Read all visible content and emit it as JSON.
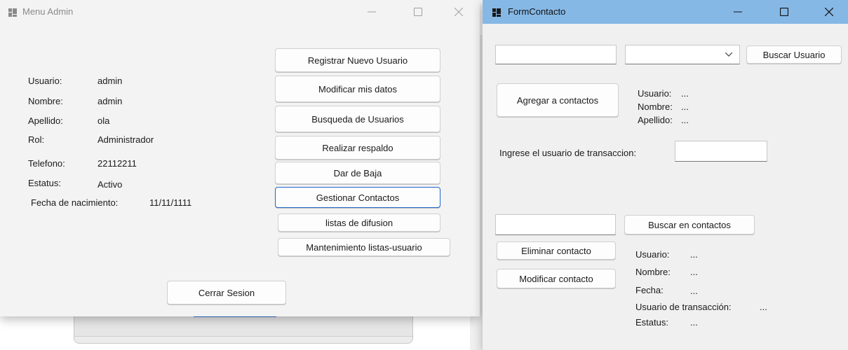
{
  "menu_admin": {
    "title": "Menu Admin",
    "info_labels": {
      "usuario": "Usuario:",
      "nombre": "Nombre:",
      "apellido": "Apellido:",
      "rol": "Rol:",
      "telefono": "Telefono:",
      "estatus": "Estatus:",
      "fecha": "Fecha de nacimiento:"
    },
    "info_values": {
      "usuario": "admin",
      "nombre": "admin",
      "apellido": "ola",
      "rol": "Administrador",
      "telefono": "22112211",
      "estatus": "Activo",
      "fecha": "11/11/1111"
    },
    "buttons": {
      "registrar": "Registrar Nuevo Usuario",
      "modificar": "Modificar mis datos",
      "busqueda": "Busqueda de Usuarios",
      "respaldo": "Realizar respaldo",
      "baja": "Dar de Baja",
      "contactos": "Gestionar Contactos",
      "listas": "listas de difusion",
      "mantenimiento": "Mantenimiento listas-usuario",
      "cerrar": "Cerrar Sesion"
    }
  },
  "form_contacto": {
    "title": "FormContacto",
    "search_input_value": "",
    "combo_selected": "",
    "buttons": {
      "buscar_usuario": "Buscar Usuario",
      "agregar": "Agregar a contactos",
      "buscar_contactos": "Buscar en contactos",
      "eliminar": "Eliminar contacto",
      "modificar": "Modificar contacto"
    },
    "top_info": {
      "usuario_label": "Usuario:",
      "usuario_value": "...",
      "nombre_label": "Nombre:",
      "nombre_value": "...",
      "apellido_label": "Apellido:",
      "apellido_value": "..."
    },
    "transaccion_prompt": "Ingrese el usuario de transaccion:",
    "transaccion_value": "",
    "contact_search_value": "",
    "bottom_info": {
      "usuario_label": "Usuario:",
      "usuario_value": "...",
      "nombre_label": "Nombre:",
      "nombre_value": "...",
      "fecha_label": "Fecha:",
      "fecha_value": "...",
      "transaccion_label": "Usuario de transacción:",
      "transaccion_value": "...",
      "estatus_label": "Estatus:",
      "estatus_value": "..."
    }
  },
  "colors": {
    "active_titlebar": "#86b8e6",
    "focus_border": "#1f66c7",
    "window_bg": "#f0f0f0"
  }
}
